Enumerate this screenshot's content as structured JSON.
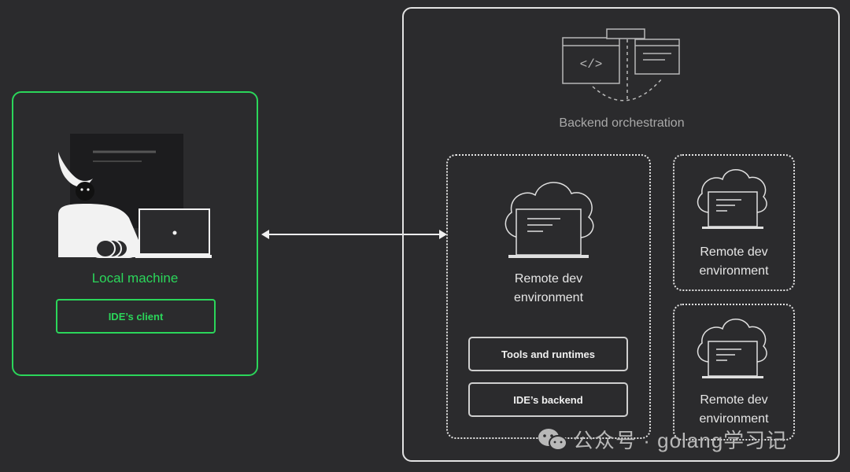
{
  "local": {
    "title": "Local machine",
    "client_label": "IDE’s client"
  },
  "backend": {
    "label": "Backend orchestration"
  },
  "remote_main": {
    "title_line1": "Remote dev",
    "title_line2": "environment",
    "tools_label": "Tools and runtimes",
    "backend_label": "IDE’s backend"
  },
  "remote_small_1": {
    "title_line1": "Remote dev",
    "title_line2": "environment"
  },
  "remote_small_2": {
    "title_line1": "Remote dev",
    "title_line2": "environment"
  },
  "watermark": {
    "text": "公众号 · golang学习记"
  },
  "colors": {
    "background": "#2b2b2d",
    "accent_green": "#2bd65a",
    "line": "#e2e2e2"
  }
}
